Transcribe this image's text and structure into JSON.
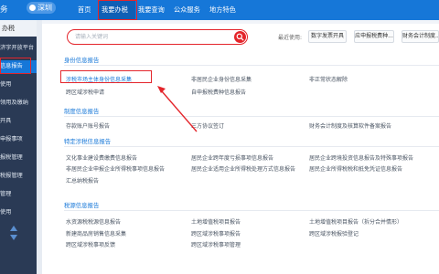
{
  "topbar": {
    "brand_partial": "务局",
    "city": "深圳",
    "nav": [
      {
        "label": "首页"
      },
      {
        "label": "我要办税"
      },
      {
        "label": "我要查询"
      },
      {
        "label": "公众服务"
      },
      {
        "label": "地方特色"
      }
    ]
  },
  "sidebar": {
    "head": "办税",
    "items": [
      "济字开放平台",
      "信息报告",
      "使用",
      "领用及缴纳",
      "开具",
      "申报事项",
      "报税管理",
      "税报管理",
      "管理",
      "使用"
    ]
  },
  "search": {
    "placeholder": "请输入关键词"
  },
  "recent": {
    "label": "最近使用:",
    "items": [
      "数字发票开具",
      "应申报税费种...",
      "财务会计制度..."
    ]
  },
  "sections": [
    {
      "title": "身份信息报告",
      "links": [
        "涉税市场主体身份信息采集",
        "非居民企业身份信息采集",
        "非正常状态解除",
        "跨区域涉税申请",
        "自申报税费种信息报告"
      ]
    },
    {
      "title": "制度信息报告",
      "links": [
        "存款账户账号报告",
        "三方协议签订",
        "财务会计制度及核算软件备案报告"
      ]
    },
    {
      "title": "特定涉税信息报告",
      "links": [
        "文化事业建设费缴费信息报告",
        "居民企业跨年度亏损事项信息报告",
        "居民企业跨境投资信息报告及特殊事项报告",
        "非居民企业申报企业所得税事项信息报告",
        "居民企业适用企业所得税处理方式信息报告",
        "居民企业所得税税和抵免凭证信息报告",
        "汇总纳税报告"
      ]
    },
    {
      "title": "税源信息报告",
      "links": [
        "水资源税税源信息报告",
        "土地增值税项目报告",
        "土地增值税项目报告（拆分合并情形）",
        "新建商品房销售信息采集",
        "跨区域涉税事项报告",
        "跨区域涉税报验登记",
        "跨区域涉税事项反馈",
        "跨区域涉税事项管理"
      ]
    }
  ],
  "colors": {
    "brand_blue": "#1677d8",
    "highlight_red": "#e4252b",
    "sidebar_bg": "#2a3a55"
  }
}
